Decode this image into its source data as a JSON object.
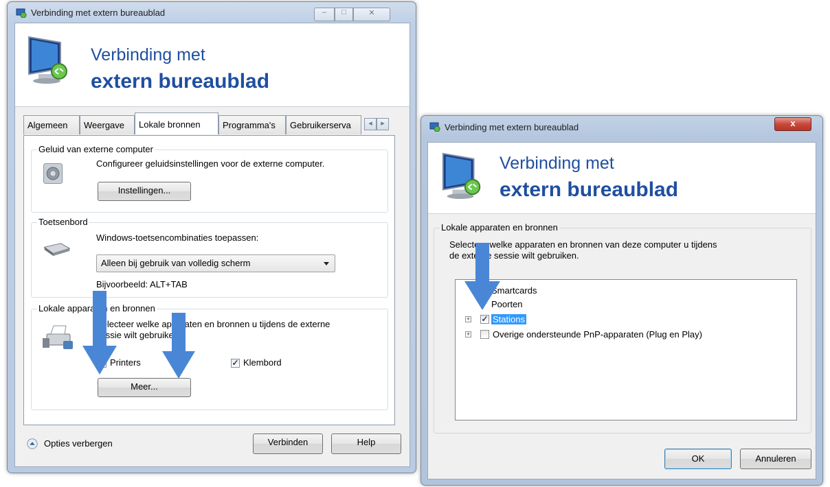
{
  "colors": {
    "accent_blue": "#1f4fa0",
    "arrow_blue": "#4a86d6",
    "close_red": "#c9473b"
  },
  "left_window": {
    "title": "Verbinding met extern bureaublad",
    "controls": {
      "minimize": "–",
      "maximize": "□",
      "close": "✕"
    },
    "banner_line1": "Verbinding met",
    "banner_line2": "extern bureaublad",
    "tabs": [
      "Algemeen",
      "Weergave",
      "Lokale bronnen",
      "Programma's",
      "Gebruikerserva"
    ],
    "active_tab": "Lokale bronnen",
    "tab_scroll": {
      "left": "◂",
      "right": "▸"
    },
    "sound": {
      "title": "Geluid van externe computer",
      "description": "Configureer geluidsinstellingen voor de externe computer.",
      "button": "Instellingen...",
      "icon": "speaker-icon"
    },
    "keyboard": {
      "title": "Toetsenbord",
      "description": "Windows-toetsencombinaties toepassen:",
      "selected": "Alleen bij gebruik van volledig scherm",
      "example": "Bijvoorbeeld: ALT+TAB",
      "icon": "keyboard-icon"
    },
    "local": {
      "title": "Lokale apparaten en bronnen",
      "description_line1": "Selecteer welke apparaten en bronnen u tijdens de externe",
      "description_line2": "sessie wilt gebruiken.",
      "printers_label": "Printers",
      "printers_checked": true,
      "clipboard_label": "Klembord",
      "clipboard_checked": true,
      "more_button": "Meer...",
      "icon": "printer-icon"
    },
    "options_label": "Opties verbergen",
    "connect_button": "Verbinden",
    "help_button": "Help"
  },
  "right_window": {
    "title": "Verbinding met extern bureaublad",
    "close": "x",
    "banner_line1": "Verbinding met",
    "banner_line2": "extern bureaublad",
    "group_title": "Lokale apparaten en bronnen",
    "description_line1": "Selecteer welke apparaten en bronnen van deze computer u tijdens",
    "description_line2": "de externe sessie wilt gebruiken.",
    "tree": [
      {
        "label": "Smartcards",
        "checked": false,
        "expandable": false
      },
      {
        "label": "Poorten",
        "checked": false,
        "expandable": false
      },
      {
        "label": "Stations",
        "checked": true,
        "expandable": true,
        "selected": true
      },
      {
        "label": "Overige ondersteunde PnP-apparaten (Plug en Play)",
        "checked": false,
        "expandable": true
      }
    ],
    "ok_button": "OK",
    "cancel_button": "Annuleren"
  }
}
